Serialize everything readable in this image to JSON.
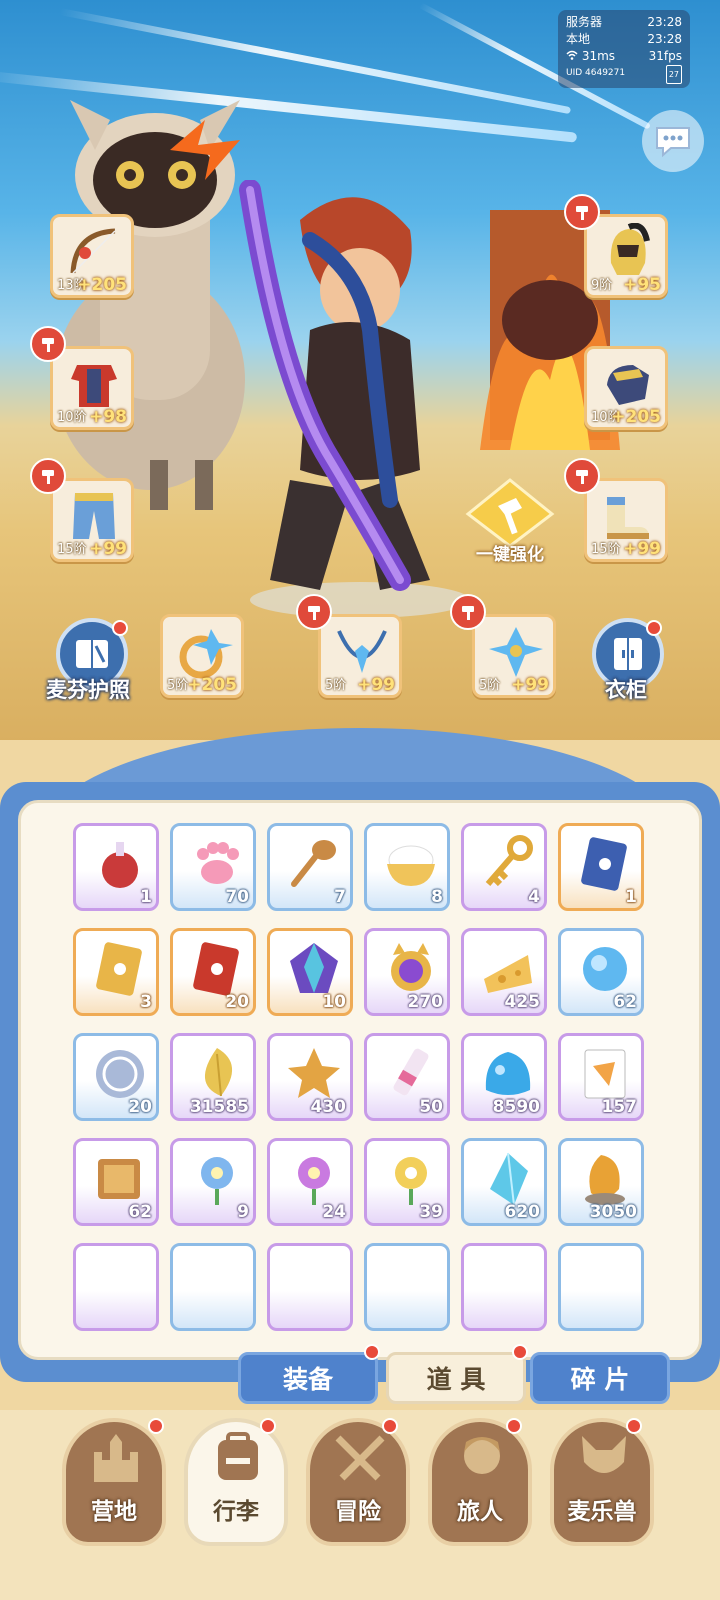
{
  "hud": {
    "server_label": "服务器",
    "server_time": "23:28",
    "local_label": "本地",
    "local_time": "23:28",
    "ping": "31ms",
    "fps": "31fps",
    "uid": "UID 4649271",
    "battery": "27"
  },
  "equipment": {
    "weapon": {
      "level": "13阶",
      "bonus": "+205"
    },
    "chest": {
      "level": "10阶",
      "bonus": "+98"
    },
    "pants": {
      "level": "15阶",
      "bonus": "+99"
    },
    "helmet": {
      "level": "9阶",
      "bonus": "+95"
    },
    "gloves": {
      "level": "10阶",
      "bonus": "+205"
    },
    "boots": {
      "level": "15阶",
      "bonus": "+99"
    },
    "ring": {
      "level": "5阶",
      "bonus": "+205"
    },
    "necklace": {
      "level": "5阶",
      "bonus": "+99"
    },
    "charm": {
      "level": "5阶",
      "bonus": "+99"
    }
  },
  "buttons": {
    "passport": "麦芬护照",
    "wardrobe": "衣柜",
    "one_key_enhance": "一键强化"
  },
  "items": [
    {
      "icon": "potion-icon",
      "count": "1",
      "rarity": "purple"
    },
    {
      "icon": "paw-icon",
      "count": "70",
      "rarity": "blue"
    },
    {
      "icon": "spoon-icon",
      "count": "7",
      "rarity": "blue"
    },
    {
      "icon": "rice-bowl-icon",
      "count": "8",
      "rarity": "blue"
    },
    {
      "icon": "key-icon",
      "count": "4",
      "rarity": "purple"
    },
    {
      "icon": "blue-card-icon",
      "count": "1",
      "rarity": "orange"
    },
    {
      "icon": "gold-card-icon",
      "count": "3",
      "rarity": "orange"
    },
    {
      "icon": "red-card-icon",
      "count": "20",
      "rarity": "orange"
    },
    {
      "icon": "gem-icon",
      "count": "10",
      "rarity": "orange"
    },
    {
      "icon": "cat-orb-icon",
      "count": "270",
      "rarity": "purple"
    },
    {
      "icon": "cheese-icon",
      "count": "425",
      "rarity": "purple"
    },
    {
      "icon": "blue-orb-icon",
      "count": "62",
      "rarity": "blue"
    },
    {
      "icon": "coin-icon",
      "count": "20",
      "rarity": "blue"
    },
    {
      "icon": "leaf-icon",
      "count": "31585",
      "rarity": "purple"
    },
    {
      "icon": "star-cookie-icon",
      "count": "430",
      "rarity": "purple"
    },
    {
      "icon": "tube-icon",
      "count": "50",
      "rarity": "purple"
    },
    {
      "icon": "slime-icon",
      "count": "8590",
      "rarity": "purple"
    },
    {
      "icon": "ticket-icon",
      "count": "157",
      "rarity": "purple"
    },
    {
      "icon": "book-icon",
      "count": "62",
      "rarity": "purple"
    },
    {
      "icon": "blue-flower-icon",
      "count": "9",
      "rarity": "purple"
    },
    {
      "icon": "purple-flower-icon",
      "count": "24",
      "rarity": "purple"
    },
    {
      "icon": "yellow-flower-icon",
      "count": "39",
      "rarity": "purple"
    },
    {
      "icon": "crystal-icon",
      "count": "620",
      "rarity": "blue"
    },
    {
      "icon": "amber-icon",
      "count": "3050",
      "rarity": "blue"
    }
  ],
  "tabs": {
    "equipment": "装备",
    "props": "道 具",
    "fragments": "碎 片"
  },
  "nav": {
    "camp": "营地",
    "luggage": "行李",
    "adventure": "冒险",
    "traveler": "旅人",
    "pet": "麦乐兽"
  },
  "colors": {
    "accent_red": "#e84a3a",
    "frame_blue": "#5b8ed0",
    "gold": "#ffe27a"
  }
}
